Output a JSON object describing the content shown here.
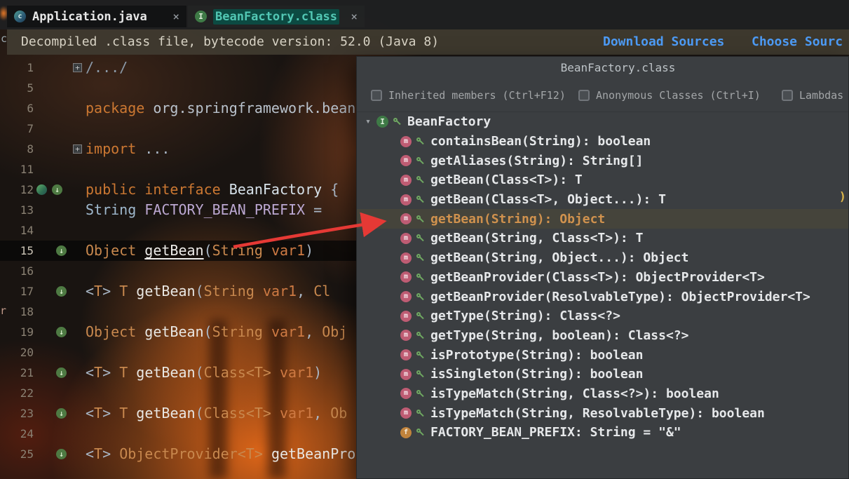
{
  "ui": {
    "close_glyph": "×"
  },
  "tabs": [
    {
      "label": "Application.java",
      "active": true
    },
    {
      "label": "BeanFactory.class",
      "active": false
    }
  ],
  "banner": {
    "message": "Decompiled .class file, bytecode version: 52.0 (Java 8)",
    "links": [
      {
        "label": "Download Sources"
      },
      {
        "label": "Choose Sourc"
      }
    ]
  },
  "artifacts": {
    "left_top": "c",
    "left_mid": "r"
  },
  "editor": {
    "lines": [
      {
        "num": "1",
        "fold": "+",
        "tokens": [
          [
            "fold",
            "/.../"
          ]
        ]
      },
      {
        "num": "5",
        "tokens": []
      },
      {
        "num": "6",
        "tokens": [
          [
            "k",
            "package "
          ],
          [
            "pkg",
            "org.springframework.bean"
          ]
        ]
      },
      {
        "num": "7",
        "tokens": []
      },
      {
        "num": "8",
        "fold": "+",
        "tokens": [
          [
            "k",
            "import "
          ],
          [
            "p",
            "..."
          ]
        ]
      },
      {
        "num": "11",
        "tokens": []
      },
      {
        "num": "12",
        "icons": [
          "class",
          "impl"
        ],
        "tokens": [
          [
            "k",
            "public interface "
          ],
          [
            "id",
            "BeanFactory "
          ],
          [
            "p",
            "{"
          ]
        ]
      },
      {
        "num": "13",
        "tokens": [
          [
            "str",
            "String "
          ],
          [
            "fld",
            "FACTORY_BEAN_PREFIX "
          ],
          [
            "p",
            "="
          ]
        ]
      },
      {
        "num": "14",
        "tokens": []
      },
      {
        "num": "15",
        "icons": [
          "impl"
        ],
        "highlight": true,
        "tokens": [
          [
            "t",
            "Object "
          ],
          [
            "ml",
            "getBean"
          ],
          [
            "p",
            "("
          ],
          [
            "t",
            "String "
          ],
          [
            "v",
            "var1"
          ],
          [
            "p",
            ")"
          ]
        ]
      },
      {
        "num": "16",
        "tokens": []
      },
      {
        "num": "17",
        "icons": [
          "impl"
        ],
        "tokens": [
          [
            "p",
            "<"
          ],
          [
            "t",
            "T"
          ],
          [
            "p",
            "> "
          ],
          [
            "t",
            "T "
          ],
          [
            "m",
            "getBean"
          ],
          [
            "p",
            "("
          ],
          [
            "t",
            "String "
          ],
          [
            "v",
            "var1"
          ],
          [
            "p",
            ", "
          ],
          [
            "t",
            "Cl"
          ]
        ]
      },
      {
        "num": "18",
        "tokens": []
      },
      {
        "num": "19",
        "icons": [
          "impl"
        ],
        "tokens": [
          [
            "t",
            "Object "
          ],
          [
            "m",
            "getBean"
          ],
          [
            "p",
            "("
          ],
          [
            "t",
            "String "
          ],
          [
            "v",
            "var1"
          ],
          [
            "p",
            ", "
          ],
          [
            "t",
            "Obj"
          ]
        ]
      },
      {
        "num": "20",
        "tokens": []
      },
      {
        "num": "21",
        "icons": [
          "impl"
        ],
        "tokens": [
          [
            "p",
            "<"
          ],
          [
            "t",
            "T"
          ],
          [
            "p",
            "> "
          ],
          [
            "t",
            "T "
          ],
          [
            "m",
            "getBean"
          ],
          [
            "p",
            "("
          ],
          [
            "t",
            "Class<T> "
          ],
          [
            "v",
            "var1"
          ],
          [
            "p",
            ")"
          ]
        ]
      },
      {
        "num": "22",
        "tokens": []
      },
      {
        "num": "23",
        "icons": [
          "impl"
        ],
        "tokens": [
          [
            "p",
            "<"
          ],
          [
            "t",
            "T"
          ],
          [
            "p",
            "> "
          ],
          [
            "t",
            "T "
          ],
          [
            "m",
            "getBean"
          ],
          [
            "p",
            "("
          ],
          [
            "t",
            "Class<T> "
          ],
          [
            "v",
            "var1"
          ],
          [
            "p",
            ", "
          ],
          [
            "t",
            "Ob"
          ]
        ]
      },
      {
        "num": "24",
        "tokens": []
      },
      {
        "num": "25",
        "icons": [
          "impl"
        ],
        "tokens": [
          [
            "p",
            "<"
          ],
          [
            "t",
            "T"
          ],
          [
            "p",
            "> "
          ],
          [
            "t",
            "ObjectProvider<T> "
          ],
          [
            "m",
            "getBeanPro"
          ]
        ]
      }
    ]
  },
  "popup": {
    "title": "BeanFactory.class",
    "filters": [
      {
        "label": "Inherited members (Ctrl+F12)",
        "checked": false
      },
      {
        "label": "Anonymous Classes (Ctrl+I)",
        "checked": false
      },
      {
        "label": "Lambdas",
        "checked": false
      }
    ],
    "root": {
      "label": "BeanFactory",
      "expanded": true
    },
    "rows": [
      {
        "label": "containsBean(String): boolean",
        "icon": "method"
      },
      {
        "label": "getAliases(String): String[]",
        "icon": "method"
      },
      {
        "label": "getBean(Class<T>): T",
        "icon": "method"
      },
      {
        "label": "getBean(Class<T>, Object...): T",
        "icon": "method"
      },
      {
        "label": "getBean(String): Object",
        "icon": "method",
        "selected": true
      },
      {
        "label": "getBean(String, Class<T>): T",
        "icon": "method"
      },
      {
        "label": "getBean(String, Object...): Object",
        "icon": "method"
      },
      {
        "label": "getBeanProvider(Class<T>): ObjectProvider<T>",
        "icon": "method"
      },
      {
        "label": "getBeanProvider(ResolvableType): ObjectProvider<T>",
        "icon": "method"
      },
      {
        "label": "getType(String): Class<?>",
        "icon": "method"
      },
      {
        "label": "getType(String, boolean): Class<?>",
        "icon": "method"
      },
      {
        "label": "isPrototype(String): boolean",
        "icon": "method"
      },
      {
        "label": "isSingleton(String): boolean",
        "icon": "method"
      },
      {
        "label": "isTypeMatch(String, Class<?>): boolean",
        "icon": "method"
      },
      {
        "label": "isTypeMatch(String, ResolvableType): boolean",
        "icon": "method"
      },
      {
        "label": "FACTORY_BEAN_PREFIX: String = \"&\"",
        "icon": "field"
      }
    ],
    "overflow_mark": ")",
    "colors": {
      "selection_bg": "#45443B",
      "selection_text": "#D0924E"
    }
  },
  "annotation": {
    "arrow_color": "#E53935"
  }
}
